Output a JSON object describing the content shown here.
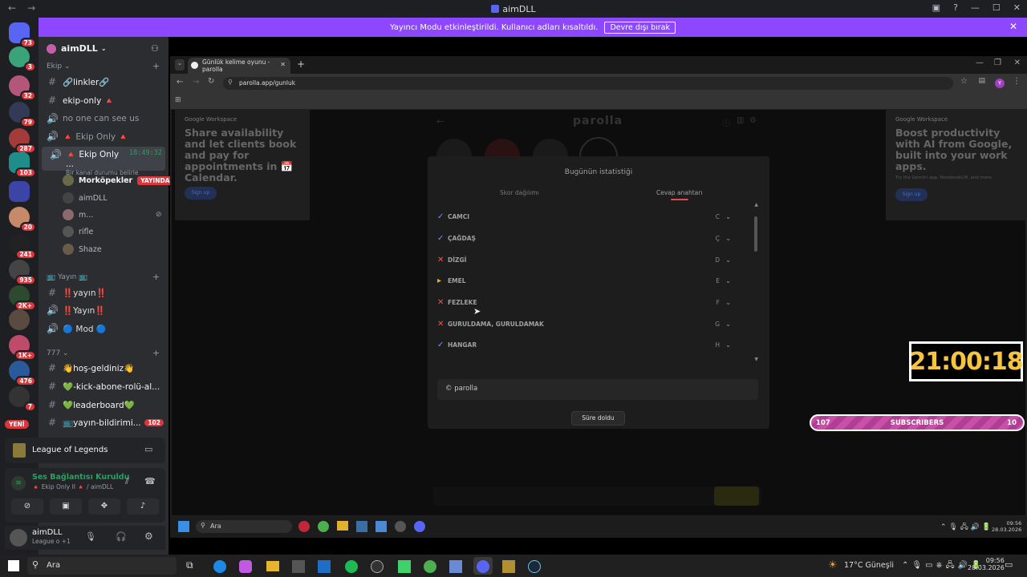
{
  "window": {
    "title": "aimDLL"
  },
  "banner": {
    "text": "Yayıncı Modu etkinleştirildi. Kullanıcı adları kısaltıldı.",
    "button": "Devre dışı bırak"
  },
  "rail": {
    "badges": [
      "73",
      "3",
      "32",
      "79",
      "287",
      "103",
      "20",
      "241",
      "935",
      "2K+",
      "1K+",
      "476",
      "7"
    ],
    "new_label": "YENİ"
  },
  "server": {
    "name": "aimDLL"
  },
  "categories": {
    "ekip": "Ekip",
    "yayin": "Yayın",
    "c777": "777"
  },
  "channels": {
    "linkler": "🔗linkler🔗",
    "ekip_only": "ekip-only 🔺",
    "no_one": "no one can see us",
    "ekip_only_voice": "🔺 Ekip Only 🔺",
    "ekip_only_active": "🔺 Ekip Only ...",
    "timer": "18:49:32",
    "status": "Bir kanal durumu belirle",
    "yayin1": "‼️yayın‼️",
    "yayin2": "‼️Yayın‼️",
    "mod": "🔵 Mod 🔵",
    "hos_geldiniz": "👋hoş-geldiniz👋",
    "kick": "💚-kick-abone-rolü-al...",
    "leaderboard": "💚leaderboard💚",
    "yayin_bildirim": "📺yayın-bildirimi...",
    "yayin_bildirim_badge": "102"
  },
  "voice_users": [
    "Morköpekler",
    "aimDLL",
    "m...",
    "rifle",
    "Shaze"
  ],
  "live_label": "YAYINDA",
  "game": {
    "name": "League of Legends"
  },
  "voice": {
    "status": "Ses Bağlantısı Kuruldu",
    "channel": "🔺 Ekip Only II 🔺 / aimDLL"
  },
  "user": {
    "name": "aimDLL",
    "status": "League o +1"
  },
  "browser": {
    "tab": "Günlük kelime oyunu - parolla",
    "url": "parolla.app/gunluk"
  },
  "ad_left": {
    "brand": "Google Workspace",
    "text": "Share availability and let clients book and pay for appointments in 📅Calendar.",
    "btn": "Sign up"
  },
  "ad_right": {
    "brand": "Google Workspace",
    "text": "Boost productivity with AI from Google, built into your work apps.",
    "small": "Try the Gemini app, NotebookLM, and more.",
    "btn": "Sign up"
  },
  "parolla": {
    "logo": "parolla"
  },
  "modal": {
    "title": "Bugünün istatistiği",
    "tabs": [
      "Skor dağılımı",
      "Cevap anahtarı"
    ],
    "rows": [
      {
        "mark": "check",
        "word": "CAMCI",
        "letter": "C"
      },
      {
        "mark": "check",
        "word": "ÇAĞDAŞ",
        "letter": "Ç"
      },
      {
        "mark": "cross",
        "word": "DİZGİ",
        "letter": "D"
      },
      {
        "mark": "pass",
        "word": "EMEL",
        "letter": "E"
      },
      {
        "mark": "cross",
        "word": "FEZLEKE",
        "letter": "F"
      },
      {
        "mark": "cross",
        "word": "GURULDAMA, GURULDAMAK",
        "letter": "G"
      },
      {
        "mark": "check",
        "word": "HANGAR",
        "letter": "H"
      }
    ],
    "answer": "© parolla",
    "button": "Süre doldu"
  },
  "inner_taskbar": {
    "search": "Ara",
    "temp": "",
    "time": "09:56",
    "date": "28.03.2026"
  },
  "taskbar": {
    "search": "Ara",
    "weather": "17°C  Güneşli",
    "time": "09:56",
    "date": "28.03.2026"
  },
  "overlay": {
    "clock": "21:00:18",
    "subs_left": "107",
    "subs_label": "SUBSCRIBERS",
    "subs_right": "10"
  },
  "colors": {
    "blurple": "#5865f2",
    "banner": "#8c47ff",
    "green": "#23a55a",
    "red": "#da373c",
    "clock": "#f5c542"
  }
}
